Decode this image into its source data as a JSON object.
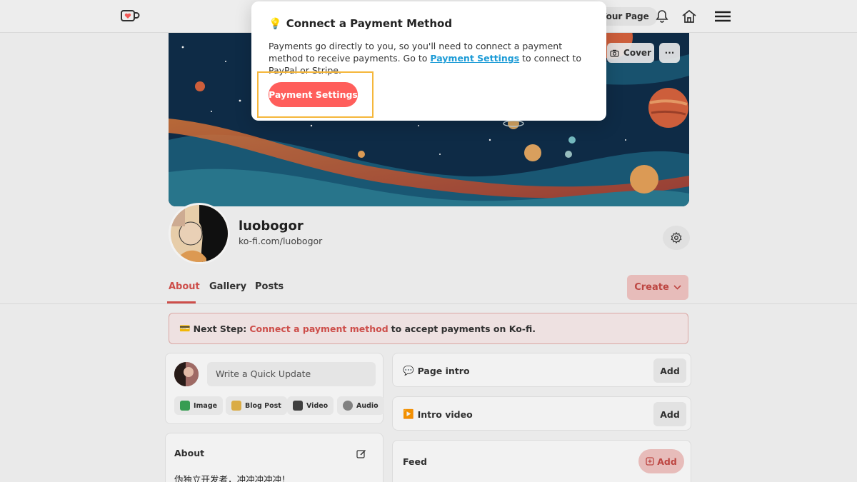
{
  "header": {
    "your_page_label": "Your Page",
    "icons": [
      "logo-cup-icon",
      "bell-icon",
      "home-icon",
      "menu-icon"
    ]
  },
  "cover": {
    "cover_button_label": "Cover",
    "more_button_label": "···"
  },
  "profile": {
    "username": "luobogor",
    "url": "ko-fi.com/luobogor"
  },
  "tabs": [
    {
      "label": "About",
      "active": true
    },
    {
      "label": "Gallery",
      "active": false
    },
    {
      "label": "Posts",
      "active": false
    }
  ],
  "create_button_label": "Create",
  "next_step": {
    "emoji": "💳",
    "prefix": "Next Step:",
    "link": "Connect a payment method",
    "suffix": "to accept payments on Ko-fi."
  },
  "quick_update": {
    "placeholder": "Write a Quick Update",
    "chips": [
      {
        "label": "Image",
        "color": "#3aa657"
      },
      {
        "label": "Blog Post",
        "color": "#e6b64a"
      },
      {
        "label": "Video",
        "color": "#444444"
      },
      {
        "label": "Audio",
        "color": "#888888"
      }
    ]
  },
  "about": {
    "title": "About",
    "text": "伪独立开发者，冲冲冲冲冲！"
  },
  "page_intro": {
    "emoji": "💬",
    "title": "Page intro",
    "add_label": "Add"
  },
  "intro_video": {
    "emoji": "▶️",
    "title": "Intro video",
    "add_label": "Add"
  },
  "feed": {
    "title": "Feed",
    "add_label": "Add"
  },
  "modal": {
    "emoji": "💡",
    "title": "Connect a Payment Method",
    "body_1": "Payments go directly to you, so you'll need to connect a payment method to receive payments. Go to",
    "body_link": "Payment Settings",
    "body_2": "to connect to PayPal or Stripe.",
    "button_label": "Payment Settings"
  },
  "colors": {
    "accent": "#ff5e5b",
    "link_blue": "#1c9bd6",
    "highlight": "#f5b73b"
  }
}
